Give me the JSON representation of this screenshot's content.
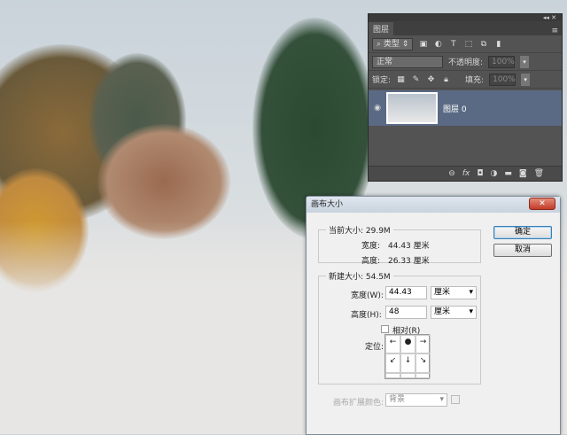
{
  "layers_panel": {
    "collapse": "◂◂ ✕",
    "tab": "图层",
    "filter": "类型",
    "blend_mode": "正常",
    "opacity_label": "不透明度:",
    "opacity": "100%",
    "lock_label": "锁定:",
    "fill_label": "填充:",
    "fill": "100%",
    "layers": [
      {
        "name": "图层 0",
        "visible": true
      }
    ]
  },
  "dialog": {
    "title": "画布大小",
    "close": "✕",
    "current": {
      "legend": "当前大小: 29.9M",
      "width_label": "宽度:",
      "width": "44.43 厘米",
      "height_label": "高度:",
      "height": "26.33 厘米"
    },
    "new": {
      "legend": "新建大小: 54.5M",
      "width_label": "宽度(W):",
      "width": "44.43",
      "width_unit": "厘米",
      "height_label": "高度(H):",
      "height": "48",
      "height_unit": "厘米",
      "relative_label": "相对(R)",
      "relative_checked": false,
      "anchor_label": "定位:",
      "anchor": [
        "←",
        "●",
        "→",
        "↙",
        "↓",
        "↘",
        "",
        "",
        ""
      ]
    },
    "extension_color_label": "画布扩展颜色:",
    "extension_color": "背景",
    "ok": "确定",
    "cancel": "取消"
  }
}
